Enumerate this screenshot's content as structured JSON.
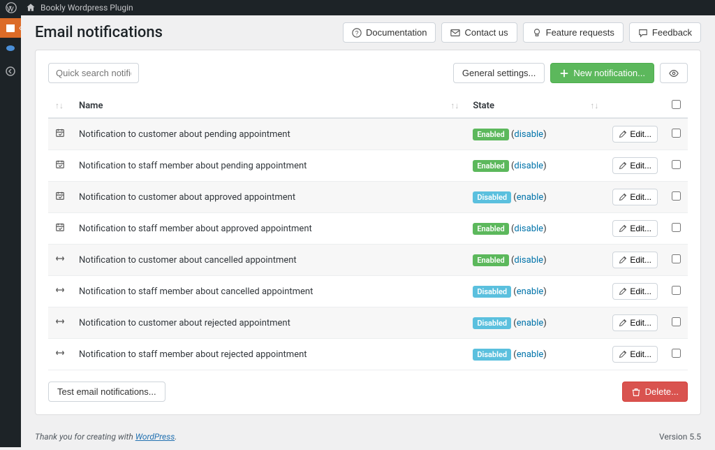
{
  "adminbar": {
    "site_name": "Bookly Wordpress Plugin"
  },
  "page": {
    "title": "Email notifications"
  },
  "header_buttons": {
    "documentation": "Documentation",
    "contact": "Contact us",
    "feature": "Feature requests",
    "feedback": "Feedback"
  },
  "toolbar": {
    "search_placeholder": "Quick search notifications",
    "general_settings": "General settings...",
    "new_notification": "New notification...",
    "test_email": "Test email notifications...",
    "delete": "Delete..."
  },
  "columns": {
    "name": "Name",
    "state": "State",
    "edit": "Edit..."
  },
  "badges": {
    "enabled": "Enabled",
    "disabled": "Disabled"
  },
  "actions": {
    "disable": "disable",
    "enable": "enable"
  },
  "rows": [
    {
      "icon": "cal",
      "name": "Notification to customer about pending appointment",
      "state": "enabled"
    },
    {
      "icon": "cal",
      "name": "Notification to staff member about pending appointment",
      "state": "enabled"
    },
    {
      "icon": "cal",
      "name": "Notification to customer about approved appointment",
      "state": "disabled"
    },
    {
      "icon": "cal",
      "name": "Notification to staff member about approved appointment",
      "state": "enabled"
    },
    {
      "icon": "arr",
      "name": "Notification to customer about cancelled appointment",
      "state": "enabled"
    },
    {
      "icon": "arr",
      "name": "Notification to staff member about cancelled appointment",
      "state": "disabled"
    },
    {
      "icon": "arr",
      "name": "Notification to customer about rejected appointment",
      "state": "disabled"
    },
    {
      "icon": "arr",
      "name": "Notification to staff member about rejected appointment",
      "state": "disabled"
    }
  ],
  "footer": {
    "thanks": "Thank you for creating with ",
    "wp": "WordPress",
    "version": "Version 5.5"
  }
}
